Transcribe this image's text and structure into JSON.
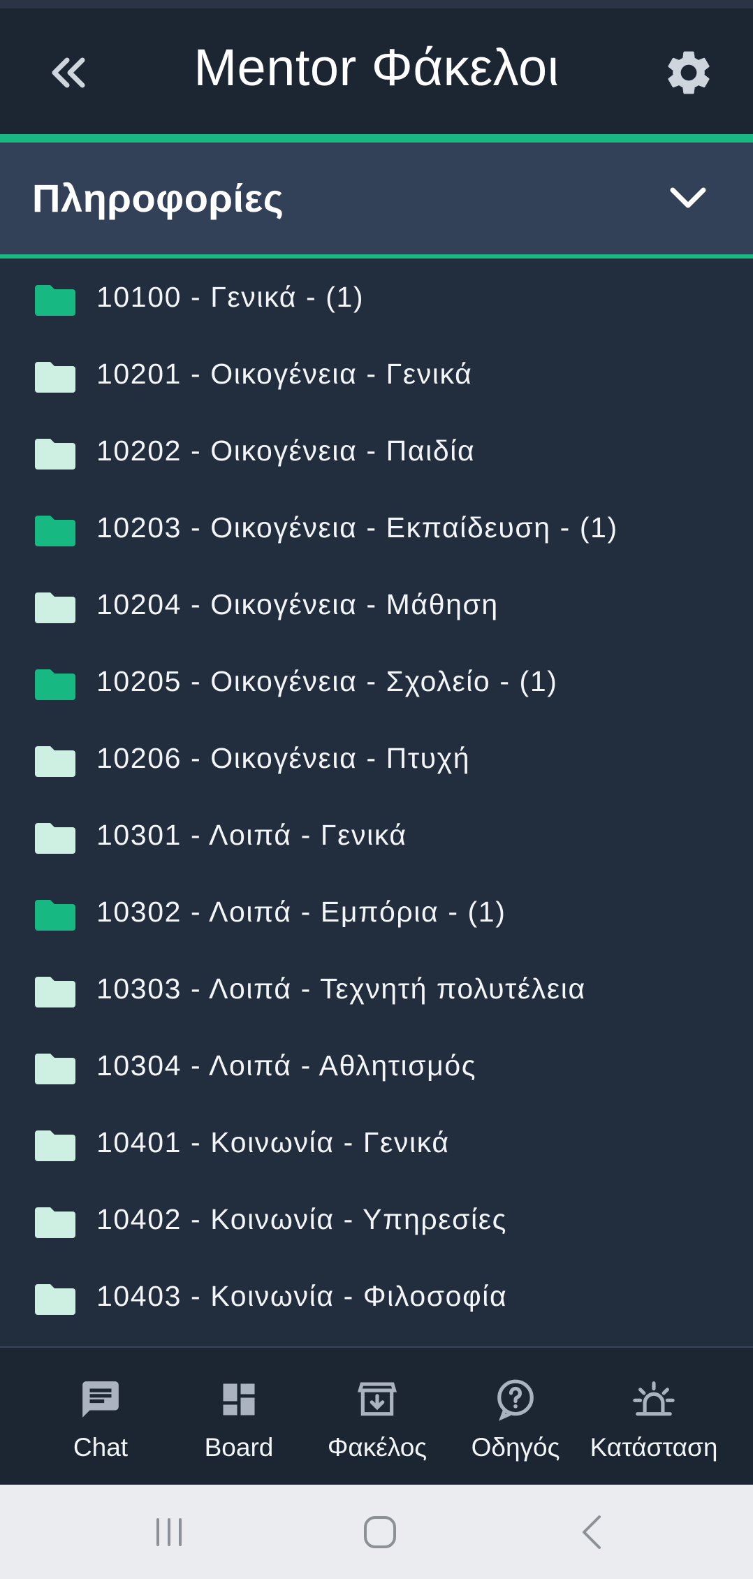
{
  "header": {
    "title": "Mentor Φάκελοι",
    "back_icon": "double-chevron-left-icon",
    "settings_icon": "gear-icon"
  },
  "section": {
    "label": "Πληροφορίες",
    "expand_icon": "chevron-down-icon"
  },
  "colors": {
    "background": "#222d3d",
    "topbar": "#1c2532",
    "section": "#334158",
    "accent": "#17b882",
    "folder_filled": "#17b882",
    "folder_empty": "#cdf0e3"
  },
  "folders": [
    {
      "label": "10100 - Γενικά - (1)",
      "has_items": true
    },
    {
      "label": "10201 - Οικογένεια - Γενικά",
      "has_items": false
    },
    {
      "label": "10202 - Οικογένεια - Παιδία",
      "has_items": false
    },
    {
      "label": "10203 - Οικογένεια - Εκπαίδευση - (1)",
      "has_items": true
    },
    {
      "label": "10204 - Οικογένεια - Μάθηση",
      "has_items": false
    },
    {
      "label": "10205 - Οικογένεια - Σχολείο - (1)",
      "has_items": true
    },
    {
      "label": "10206 - Οικογένεια - Πτυχή",
      "has_items": false
    },
    {
      "label": "10301 - Λοιπά - Γενικά",
      "has_items": false
    },
    {
      "label": "10302 - Λοιπά - Εμπόρια - (1)",
      "has_items": true
    },
    {
      "label": "10303 - Λοιπά - Τεχνητή πολυτέλεια",
      "has_items": false
    },
    {
      "label": "10304 - Λοιπά - Αθλητισμός",
      "has_items": false
    },
    {
      "label": "10401 - Κοινωνία - Γενικά",
      "has_items": false
    },
    {
      "label": "10402 - Κοινωνία - Υπηρεσίες",
      "has_items": false
    },
    {
      "label": "10403 - Κοινωνία - Φιλοσοφία",
      "has_items": false
    }
  ],
  "bottom_nav": [
    {
      "label": "Chat",
      "icon": "chat-icon"
    },
    {
      "label": "Board",
      "icon": "dashboard-icon"
    },
    {
      "label": "Φακέλος",
      "icon": "archive-download-icon"
    },
    {
      "label": "Οδηγός",
      "icon": "help-icon"
    },
    {
      "label": "Κατάσταση",
      "icon": "siren-icon"
    }
  ],
  "system_nav": {
    "recents_icon": "recents-icon",
    "home_icon": "home-icon",
    "back_icon": "system-back-icon"
  }
}
